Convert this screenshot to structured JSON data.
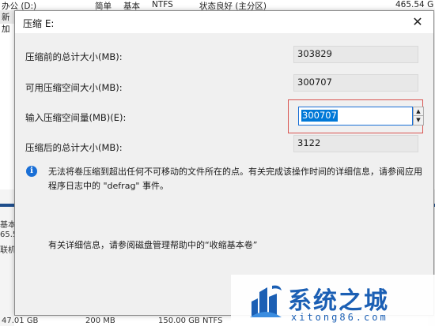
{
  "background": {
    "top_row": {
      "volume": "办公 (D:)",
      "layout": "简单",
      "type": "基本",
      "fs": "NTFS",
      "status": "状态良好 (主分区)",
      "capacity": "465.54 G"
    },
    "second_row_partial": "新加",
    "left_panel": [
      "基本",
      "65.5",
      "联机"
    ],
    "bottom_row": [
      "47.01 GB",
      "200 MB",
      "150.00 GB NTFS"
    ]
  },
  "dialog": {
    "title": "压缩 E:",
    "close_glyph": "✕",
    "fields": {
      "total_before": {
        "label": "压缩前的总计大小(MB):",
        "value": "303829"
      },
      "available": {
        "label": "可用压缩空间大小(MB):",
        "value": "300707"
      },
      "shrink_amount": {
        "label": "输入压缩空间量(MB)(E):",
        "value": "300707"
      },
      "total_after": {
        "label": "压缩后的总计大小(MB):",
        "value": "3122"
      }
    },
    "spinner": {
      "up": "▲",
      "down": "▼"
    },
    "info_icon": "i",
    "info_text": "无法将卷压缩到超出任何不可移动的文件所在的点。有关完成该操作时间的详细信息，请参阅应用程序日志中的 \"defrag\" 事件。",
    "help_text": "有关详细信息，请参阅磁盘管理帮助中的“收缩基本卷”"
  },
  "watermark": {
    "text": "系统之城",
    "url": "xitong86.com"
  },
  "colors": {
    "accent": "#0078d7",
    "highlight_border": "#d9534f",
    "watermark_blue": "#1b5fb4"
  }
}
